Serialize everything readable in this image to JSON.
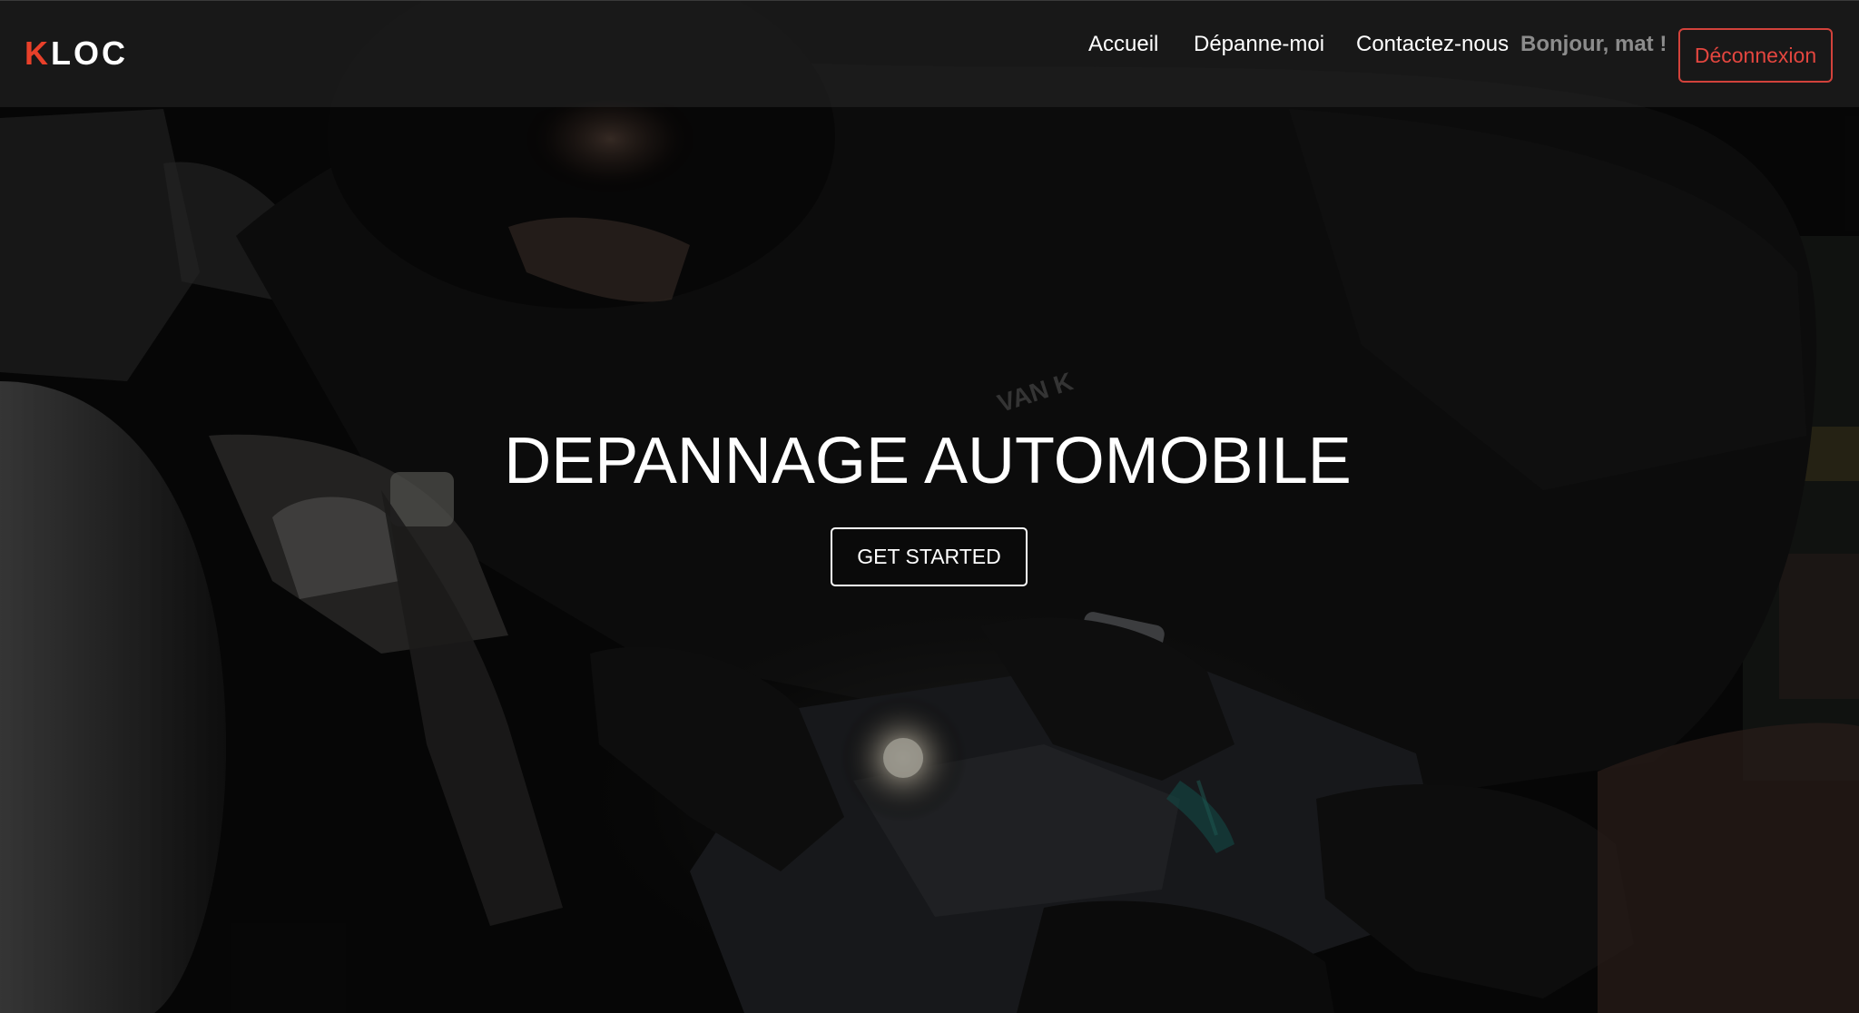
{
  "navbar": {
    "logo": {
      "first_letter": "K",
      "rest": "LOC"
    },
    "links": [
      {
        "label": "Accueil"
      },
      {
        "label": "Dépanne-moi"
      },
      {
        "label": "Contactez-nous"
      }
    ],
    "greeting": "Bonjour, mat !",
    "logout_label": "Déconnexion"
  },
  "hero": {
    "title": "DEPANNAGE AUTOMOBILE",
    "cta_label": "GET STARTED"
  },
  "colors": {
    "brand_accent": "#e8402a",
    "logout_border": "#d2423b",
    "greeting_text": "#8c8c8c"
  }
}
